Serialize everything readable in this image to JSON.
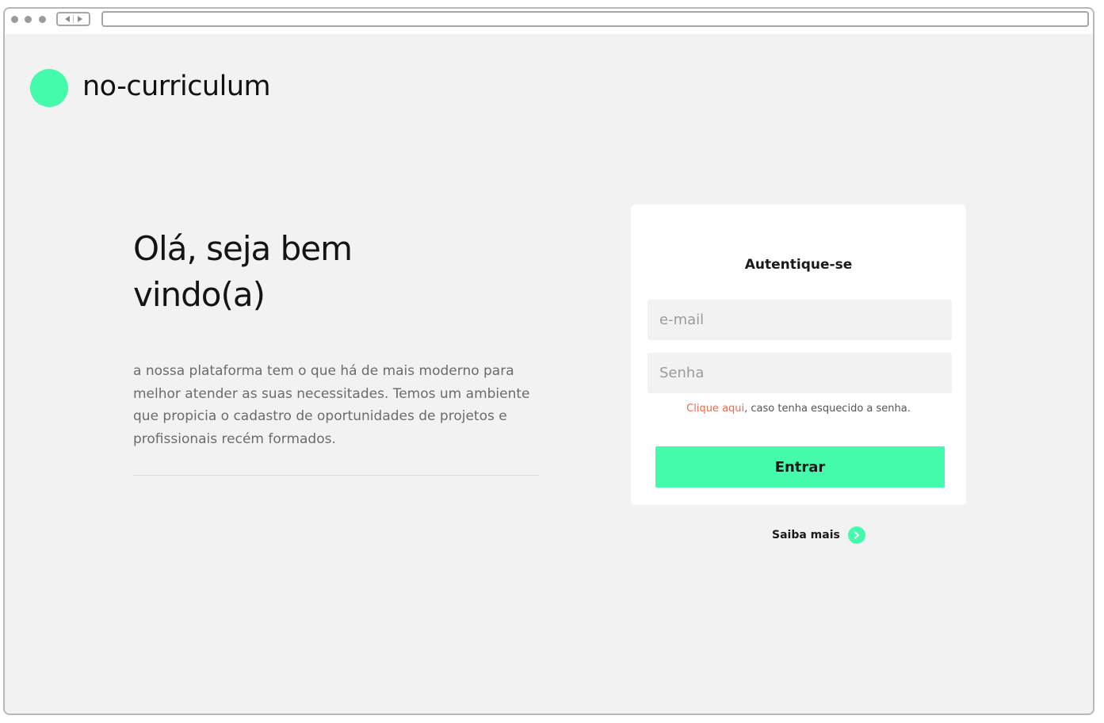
{
  "app": {
    "brand": "no-curriculum",
    "accent_color": "#43fbab",
    "link_color": "#f06a4a"
  },
  "hero": {
    "heading": "Olá, seja bem vindo(a)",
    "description": "a nossa plataforma tem o que há de mais moderno para melhor atender as suas necessitades. Temos um ambiente que propicia o cadastro de oportunidades de projetos e profissionais recém formados."
  },
  "login": {
    "title": "Autentique-se",
    "email_placeholder": "e-mail",
    "email_value": "",
    "password_placeholder": "Senha",
    "password_value": "",
    "forgot_link": "Clique aqui",
    "forgot_text": ", caso tenha esquecido a senha.",
    "submit_label": "Entrar"
  },
  "footer_link": {
    "label": "Saiba mais",
    "icon": "chevron-right-icon"
  },
  "browser_chrome": {
    "icons": [
      "window-dot-icon",
      "back-arrow-icon",
      "forward-arrow-icon"
    ]
  }
}
